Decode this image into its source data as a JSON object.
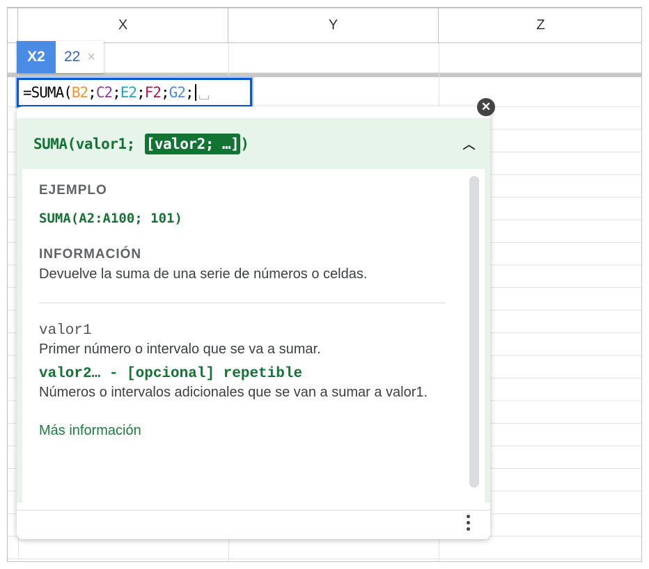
{
  "columns": [
    "X",
    "Y",
    "Z"
  ],
  "cell_chip": {
    "ref": "X2",
    "value": "22",
    "close": "×"
  },
  "editor": {
    "prefix": "=SUMA(",
    "refs": [
      {
        "text": "B2",
        "color": "#f4942f"
      },
      {
        "text": "C2",
        "color": "#8e3b9a"
      },
      {
        "text": "E2",
        "color": "#19a6c0"
      },
      {
        "text": "F2",
        "color": "#a8184b"
      },
      {
        "text": "G2",
        "color": "#4a8be6"
      }
    ],
    "sep": ";"
  },
  "popup": {
    "signature_prefix": "SUMA(valor1;",
    "signature_highlight": "[valor2; …]",
    "signature_suffix": ")",
    "example_label": "EJEMPLO",
    "example": "SUMA(A2:A100; 101)",
    "info_label": "INFORMACIÓN",
    "info": "Devuelve la suma de una serie de números o celdas.",
    "arg1_name": "valor1",
    "arg1_desc": "Primer número o intervalo que se va a sumar.",
    "arg2_name": "valor2… - [opcional] repetible",
    "arg2_desc": "Números o intervalos adicionales que se van a sumar a valor1.",
    "more_link": "Más información",
    "close": "✕",
    "collapse": "︿"
  }
}
